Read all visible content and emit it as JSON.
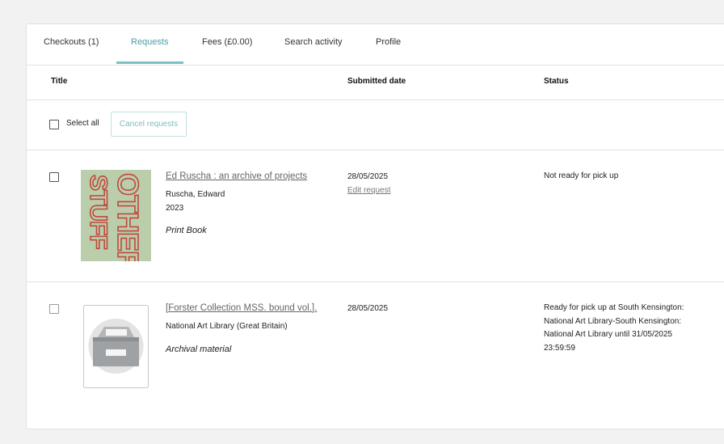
{
  "tabs": [
    {
      "label": "Checkouts (1)"
    },
    {
      "label": "Requests"
    },
    {
      "label": "Fees (£0.00)"
    },
    {
      "label": "Search activity"
    },
    {
      "label": "Profile"
    }
  ],
  "active_tab": "Requests",
  "columns": {
    "title": "Title",
    "submitted": "Submitted date",
    "status": "Status"
  },
  "select_all_label": "Select all",
  "cancel_button_label": "Cancel requests",
  "items": [
    {
      "title": "Ed Ruscha : an archive of projects",
      "author": "Ruscha, Edward",
      "year": "2023",
      "format": "Print Book",
      "submitted_date": "28/05/2025",
      "edit_label": "Edit request",
      "status_lines": [
        "Not ready for pick up"
      ],
      "cover_text": "OTHER STUFF"
    },
    {
      "title": "[Forster Collection MSS. bound vol.].",
      "author": "National Art Library (Great Britain)",
      "format": "Archival material",
      "submitted_date": "28/05/2025",
      "status_lines": [
        "Ready for pick up at South Kensington:",
        "National Art Library-South Kensington:",
        "National Art Library until 31/05/2025",
        "23:59:59"
      ]
    }
  ],
  "colors": {
    "accent": "#4b9fa3",
    "button_border": "#bfe0e1",
    "cover_bg": "#b3c9a4",
    "cover_text": "#c04a3e"
  }
}
